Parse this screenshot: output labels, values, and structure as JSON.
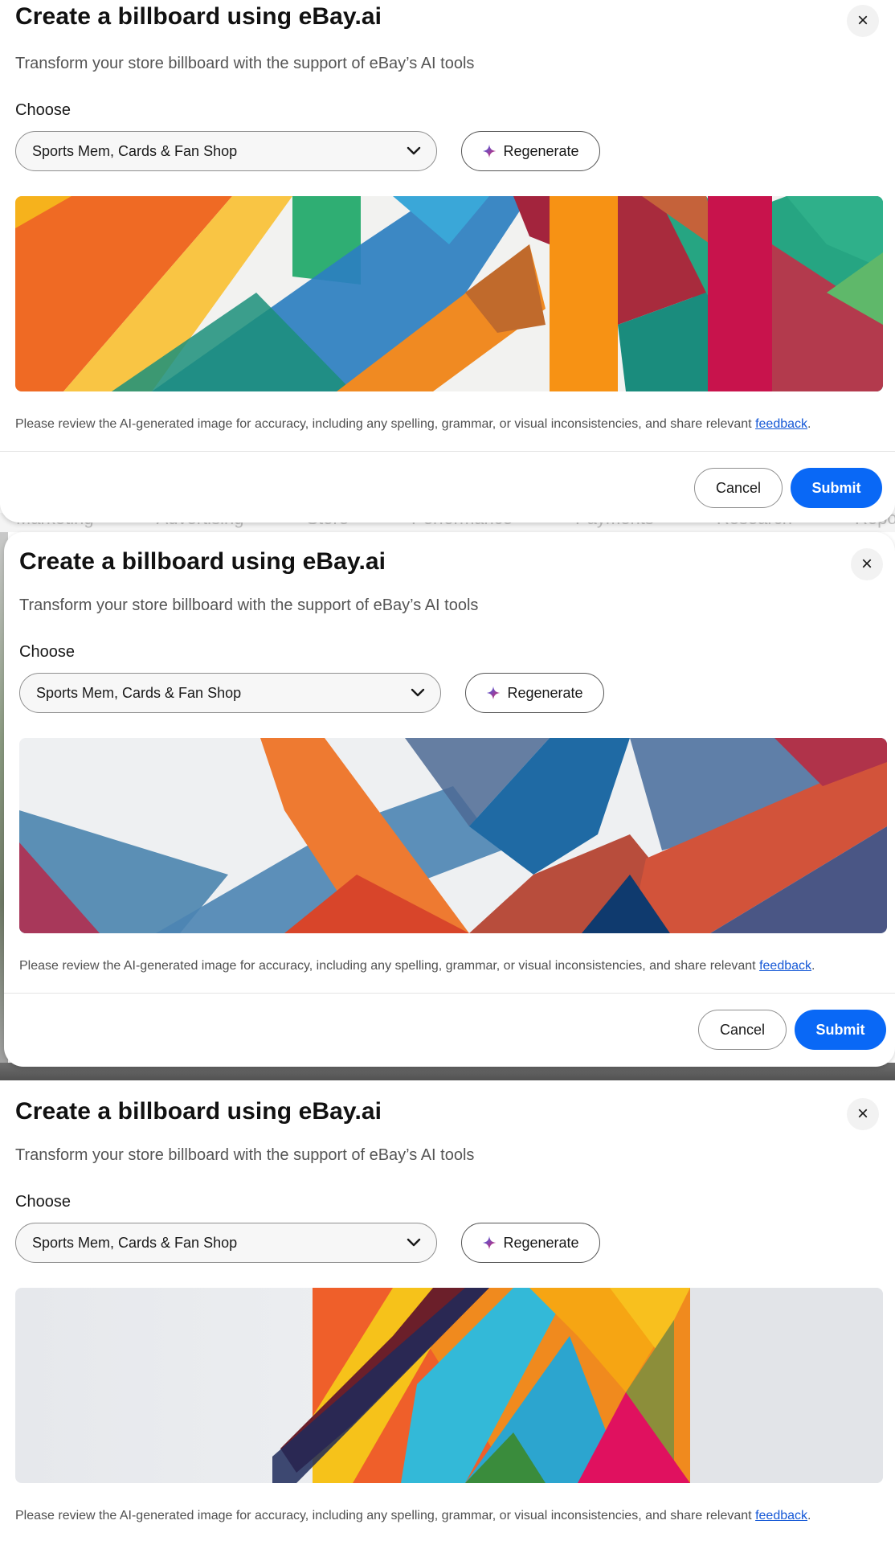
{
  "dialogs": [
    {
      "title": "Create a billboard using eBay.ai",
      "subtitle": "Transform your store billboard with the support of eBay’s AI tools",
      "choose_label": "Choose",
      "category_selected": "Sports Mem, Cards & Fan Shop",
      "regenerate_label": "Regenerate",
      "disclaimer_text": "Please review the AI-generated image for accuracy, including any spelling, grammar, or visual inconsistencies, and share relevant ",
      "feedback_link": "feedback",
      "disclaimer_end": ".",
      "cancel_label": "Cancel",
      "submit_label": "Submit",
      "close_icon": "×"
    },
    {
      "title": "Create a billboard using eBay.ai",
      "subtitle": "Transform your store billboard with the support of eBay’s AI tools",
      "choose_label": "Choose",
      "category_selected": "Sports Mem, Cards & Fan Shop",
      "regenerate_label": "Regenerate",
      "disclaimer_text": "Please review the AI-generated image for accuracy, including any spelling, grammar, or visual inconsistencies, and share relevant ",
      "feedback_link": "feedback",
      "disclaimer_end": ".",
      "cancel_label": "Cancel",
      "submit_label": "Submit",
      "close_icon": "×"
    },
    {
      "title": "Create a billboard using eBay.ai",
      "subtitle": "Transform your store billboard with the support of eBay’s AI tools",
      "choose_label": "Choose",
      "category_selected": "Sports Mem, Cards & Fan Shop",
      "regenerate_label": "Regenerate",
      "disclaimer_text": "Please review the AI-generated image for accuracy, including any spelling, grammar, or visual inconsistencies, and share relevant ",
      "feedback_link": "feedback",
      "disclaimer_end": ".",
      "close_icon": "×"
    }
  ],
  "background_tabs": [
    "Marketing",
    "Advertising",
    "Store",
    "Performance",
    "Payments",
    "Research",
    "Reports"
  ],
  "colors": {
    "primary_button": "#0968f6",
    "link": "#1558d6",
    "sparkle_blue": "#3665f3",
    "sparkle_pink": "#e0245e"
  },
  "icons": {
    "close": "close-icon",
    "chevron": "chevron-down-icon",
    "sparkle": "sparkle-icon"
  }
}
